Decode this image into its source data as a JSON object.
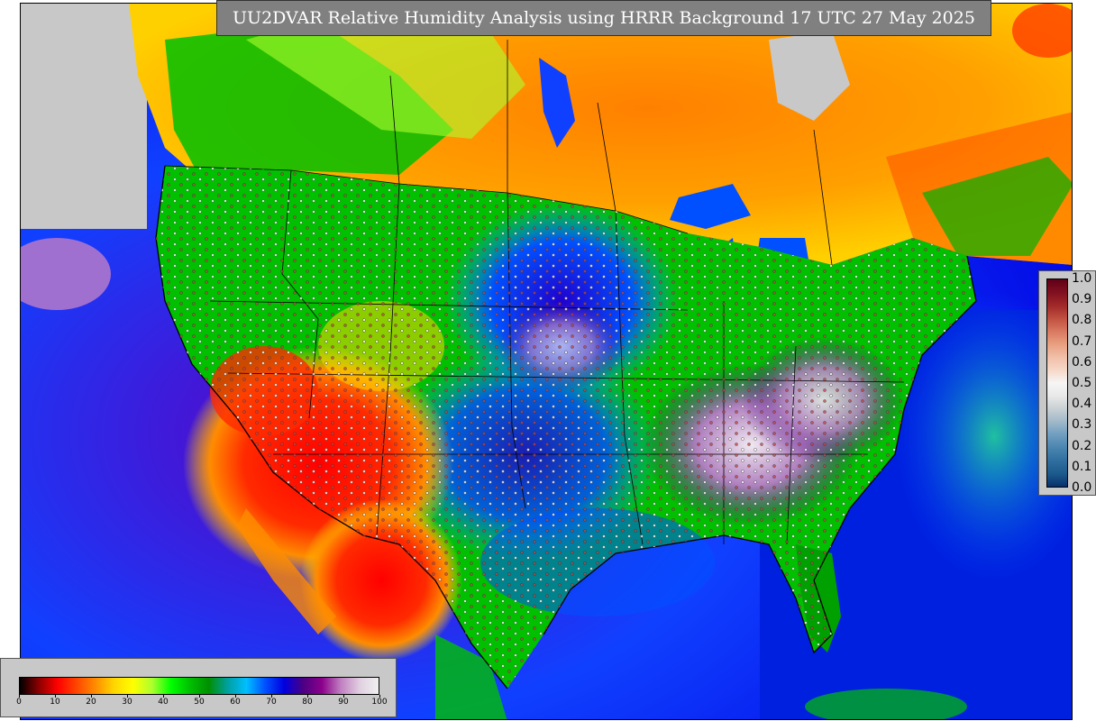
{
  "title": "UU2DVAR Relative Humidity Analysis using HRRR Background 17 UTC 27 May 2025",
  "rh_colorbar": {
    "ticks": [
      "0",
      "10",
      "20",
      "30",
      "40",
      "50",
      "60",
      "70",
      "80",
      "90",
      "100"
    ],
    "colors": [
      "#000000",
      "#8b0000",
      "#ff0000",
      "#ff4500",
      "#ff8c00",
      "#ffd700",
      "#ffff00",
      "#adff2f",
      "#00ff00",
      "#00c000",
      "#008f00",
      "#00a0a0",
      "#00bfff",
      "#0050ff",
      "#0000e0",
      "#4b0082",
      "#8b008b",
      "#c080c0",
      "#e0d0e0",
      "#f0f0f0"
    ]
  },
  "obs_colorbar": {
    "ticks": [
      "0.0",
      "0.1",
      "0.2",
      "0.3",
      "0.4",
      "0.5",
      "0.6",
      "0.7",
      "0.8",
      "0.9",
      "1.0"
    ],
    "colors": [
      "#08306b",
      "#1c5a8c",
      "#2f6e9f",
      "#4a85b0",
      "#6f9dbf",
      "#9fb8c8",
      "#c8d0d4",
      "#e8e8e8",
      "#f6f6f6",
      "#f6d8c8",
      "#f0bfa8",
      "#e8a080",
      "#d87860",
      "#c05040",
      "#a02828",
      "#801020",
      "#600018"
    ]
  },
  "map_colors": {
    "ocean": "#0000e0",
    "land_dry": "#ff0000",
    "land_mid": "#00c000",
    "canada_dry": "#ff9a00",
    "unknown": "#c8c8c8"
  }
}
